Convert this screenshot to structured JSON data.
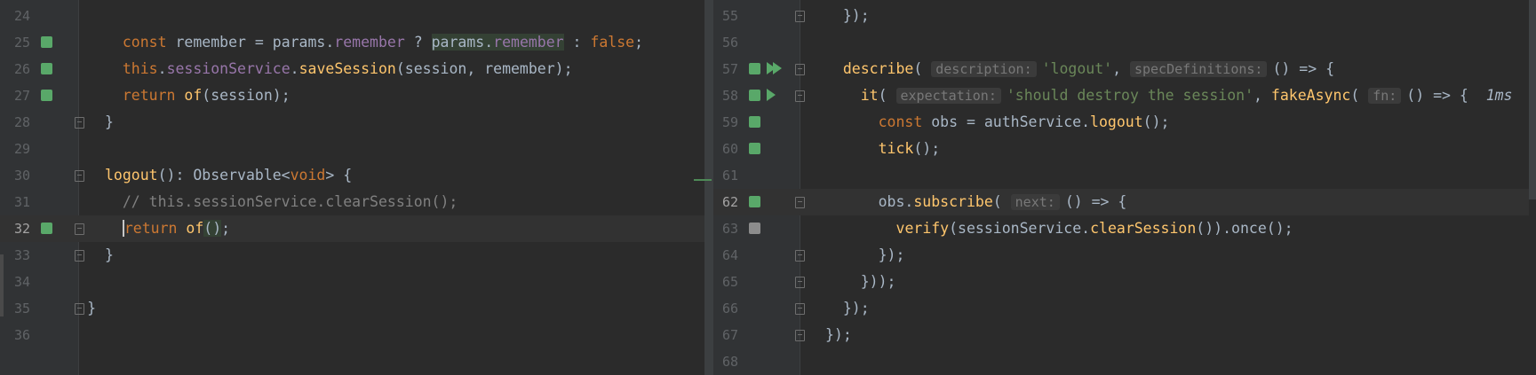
{
  "left_editor": {
    "lines": [
      {
        "num": "24",
        "marker": "",
        "fold": "",
        "text": []
      },
      {
        "num": "25",
        "marker": "green",
        "fold": "",
        "text": [
          [
            "kw",
            "const "
          ],
          [
            "",
            "remember = params."
          ],
          [
            "prop",
            "remember"
          ],
          [
            "",
            " ? "
          ],
          [
            "hl",
            "params."
          ],
          [
            "prop hl",
            "remember"
          ],
          [
            "",
            " : "
          ],
          [
            "kw",
            "false"
          ],
          [
            "",
            ";"
          ]
        ]
      },
      {
        "num": "26",
        "marker": "green",
        "fold": "",
        "text": [
          [
            "kw",
            "this"
          ],
          [
            "",
            "."
          ],
          [
            "prop",
            "sessionService"
          ],
          [
            "",
            "."
          ],
          [
            "fn",
            "saveSession"
          ],
          [
            "",
            "(session, remember);"
          ]
        ]
      },
      {
        "num": "27",
        "marker": "green",
        "fold": "",
        "text": [
          [
            "kw",
            "return "
          ],
          [
            "fn",
            "of"
          ],
          [
            "",
            "(session);"
          ]
        ]
      },
      {
        "num": "28",
        "marker": "",
        "fold": "end",
        "text": [
          [
            "",
            "}"
          ]
        ]
      },
      {
        "num": "29",
        "marker": "",
        "fold": "",
        "text": []
      },
      {
        "num": "30",
        "marker": "",
        "fold": "start",
        "text": [
          [
            "fn",
            "logout"
          ],
          [
            "",
            "(): Observable<"
          ],
          [
            "kw",
            "void"
          ],
          [
            "",
            "> {"
          ]
        ]
      },
      {
        "num": "31",
        "marker": "",
        "fold": "",
        "text": [
          [
            "cmt",
            "// this.sessionService.clearSession();"
          ]
        ]
      },
      {
        "num": "32",
        "marker": "green",
        "fold": "end",
        "current": true,
        "text": [
          [
            "kw caret",
            "return "
          ],
          [
            "fn",
            "of"
          ],
          [
            "hl",
            "()"
          ],
          [
            "",
            ";"
          ]
        ]
      },
      {
        "num": "33",
        "marker": "",
        "fold": "end",
        "text": [
          [
            "",
            "}"
          ]
        ]
      },
      {
        "num": "34",
        "marker": "",
        "fold": "",
        "text": []
      },
      {
        "num": "35",
        "marker": "",
        "fold": "end",
        "text": [
          [
            "",
            "}"
          ]
        ]
      },
      {
        "num": "36",
        "marker": "",
        "fold": "",
        "text": []
      }
    ]
  },
  "right_editor": {
    "lines": [
      {
        "num": "55",
        "marker": "",
        "fold": "end",
        "text": [
          [
            "",
            "});"
          ]
        ]
      },
      {
        "num": "56",
        "marker": "",
        "fold": "",
        "text": []
      },
      {
        "num": "57",
        "marker": "green",
        "run": "double",
        "fold": "start",
        "text": [
          [
            "fn",
            "describe"
          ],
          [
            "",
            "( "
          ],
          [
            "hint",
            "description:"
          ],
          [
            "str",
            "'logout'"
          ],
          [
            "",
            ", "
          ],
          [
            "hint",
            "specDefinitions:"
          ],
          [
            "",
            "() => {"
          ]
        ]
      },
      {
        "num": "58",
        "marker": "green",
        "run": "single",
        "fold": "start",
        "text": [
          [
            "fn",
            "it"
          ],
          [
            "",
            "( "
          ],
          [
            "hint",
            "expectation:"
          ],
          [
            "str",
            "'should destroy the session'"
          ],
          [
            "",
            ", "
          ],
          [
            "fn",
            "fakeAsync"
          ],
          [
            "",
            "( "
          ],
          [
            "hint",
            "fn:"
          ],
          [
            "",
            "() => {  "
          ],
          [
            "ital",
            "1ms"
          ]
        ]
      },
      {
        "num": "59",
        "marker": "green",
        "fold": "",
        "text": [
          [
            "kw",
            "const "
          ],
          [
            "",
            "obs = authService."
          ],
          [
            "fn",
            "logout"
          ],
          [
            "",
            "();"
          ]
        ]
      },
      {
        "num": "60",
        "marker": "green",
        "fold": "",
        "text": [
          [
            "fn",
            "tick"
          ],
          [
            "",
            "();"
          ]
        ]
      },
      {
        "num": "61",
        "marker": "",
        "fold": "",
        "text": []
      },
      {
        "num": "62",
        "marker": "green",
        "fold": "start",
        "current": true,
        "text": [
          [
            "",
            "obs."
          ],
          [
            "fn",
            "subscribe"
          ],
          [
            "",
            "( "
          ],
          [
            "hint",
            "next:"
          ],
          [
            "",
            "() => {"
          ]
        ]
      },
      {
        "num": "63",
        "marker": "gray",
        "fold": "",
        "text": [
          [
            "fn",
            "verify"
          ],
          [
            "",
            "(sessionService."
          ],
          [
            "fn",
            "clearSession"
          ],
          [
            "",
            "()).once();"
          ]
        ]
      },
      {
        "num": "64",
        "marker": "",
        "fold": "end",
        "text": [
          [
            "",
            "});"
          ]
        ]
      },
      {
        "num": "65",
        "marker": "",
        "fold": "end",
        "text": [
          [
            "",
            "}));"
          ]
        ]
      },
      {
        "num": "66",
        "marker": "",
        "fold": "end",
        "text": [
          [
            "",
            "});"
          ]
        ]
      },
      {
        "num": "67",
        "marker": "",
        "fold": "end",
        "text": [
          [
            "",
            "});"
          ]
        ]
      },
      {
        "num": "68",
        "marker": "",
        "fold": "",
        "text": []
      }
    ]
  },
  "colors": {
    "background": "#2b2b2b",
    "gutter": "#313335",
    "keyword": "#cc7832",
    "function": "#ffc66d",
    "property": "#9876aa",
    "string": "#6a8759",
    "comment": "#808080",
    "vcs_added": "#59a869",
    "vcs_unknown": "#8c8c8c"
  },
  "icons": [
    "run-icon",
    "run-all-icon",
    "fold-icon",
    "vcs-change-marker-icon"
  ]
}
